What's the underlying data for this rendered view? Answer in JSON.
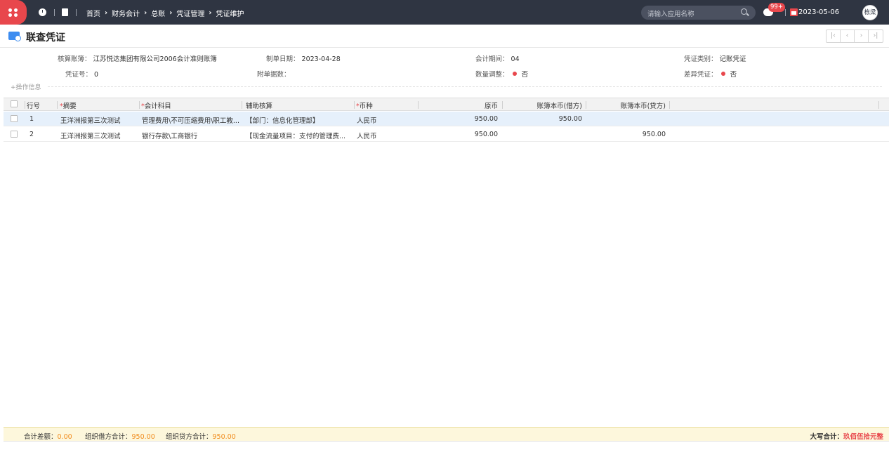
{
  "topbar": {
    "breadcrumbs": [
      "首页",
      "财务会计",
      "总账",
      "凭证管理",
      "凭证维护"
    ],
    "search_placeholder": "请输入应用名称",
    "badge_count": "99+",
    "date": "2023-05-06",
    "user": "栋梁",
    "brand_color": "#e8474c"
  },
  "page": {
    "title": "联查凭证",
    "pager": [
      "|‹",
      "‹",
      "›",
      "›|"
    ]
  },
  "header": {
    "book_label": "核算账簿：",
    "book_value": "江苏悦达集团有限公司2006会计准则账簿",
    "date_label": "制单日期：",
    "date_value": "2023-04-28",
    "period_label": "会计期间：",
    "period_value": "04",
    "type_label": "凭证类别：",
    "type_value": "记账凭证",
    "voucher_label": "凭证号：",
    "voucher_value": "0",
    "attach_label": "附单据数：",
    "attach_value": "",
    "qty_label": "数量调整：",
    "qty_value": "否",
    "diff_label": "差异凭证：",
    "diff_value": "否",
    "op_info": "+操作信息"
  },
  "table": {
    "columns": [
      "行号",
      "摘要",
      "会计科目",
      "辅助核算",
      "币种",
      "原币",
      "账簿本币(借方)",
      "账簿本币(贷方)"
    ],
    "rows": [
      {
        "no": "1",
        "summary": "王洋洲报第三次测试",
        "account": "管理费用\\不可压缩费用\\职工教...",
        "aux": "【部门：信息化管理部】",
        "currency": "人民币",
        "orig": "950.00",
        "debit": "950.00",
        "credit": ""
      },
      {
        "no": "2",
        "summary": "王洋洲报第三次测试",
        "account": "银行存款\\工商银行",
        "aux": "【现金流量项目：支付的管理费...",
        "currency": "人民币",
        "orig": "950.00",
        "debit": "",
        "credit": "950.00"
      }
    ]
  },
  "footer": {
    "diff_label": "合计差额：",
    "diff_value": "0.00",
    "debit_label": "组织借方合计：",
    "debit_value": "950.00",
    "credit_label": "组织贷方合计：",
    "credit_value": "950.00",
    "caps_label": "大写合计：",
    "caps_value": "玖佰伍拾元整"
  }
}
